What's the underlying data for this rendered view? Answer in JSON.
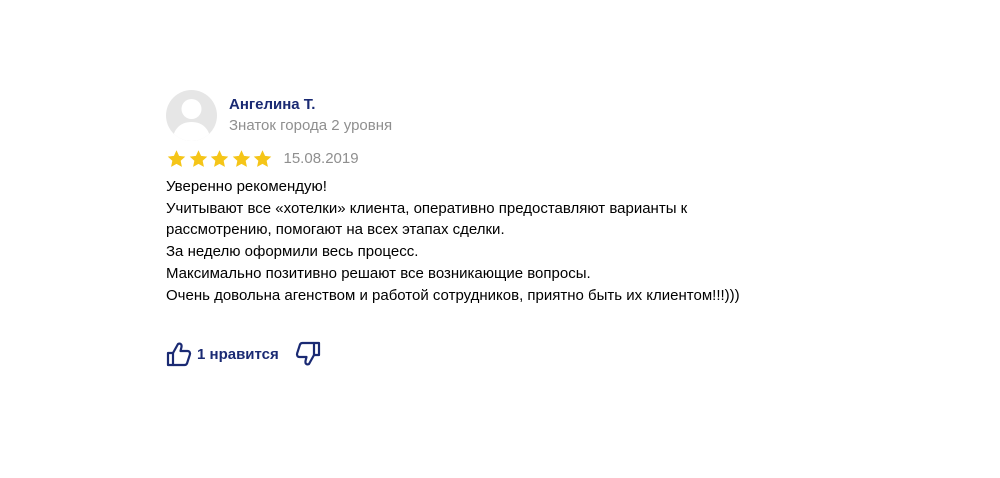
{
  "review": {
    "author_name": "Ангелина Т.",
    "author_level": "Знаток города 2 уровня",
    "rating": 5,
    "rating_max": 5,
    "date": "15.08.2019",
    "text_lines": [
      "Уверенно рекомендую!",
      "Учитывают все «хотелки» клиента, оперативно предоставляют варианты к",
      "рассмотрению, помогают на всех этапах сделки.",
      "За неделю оформили весь процесс.",
      "Максимально позитивно решают все возникающие вопросы.",
      "Очень довольна агенством и работой сотрудников, приятно быть их клиентом!!!)))"
    ],
    "likes_label": "1 нравится"
  },
  "colors": {
    "star": "#f5c518",
    "link": "#1a2a73",
    "muted": "#8f8f8f"
  },
  "icons": {
    "avatar": "user-silhouette-icon",
    "like": "thumbs-up-icon",
    "dislike": "thumbs-down-icon"
  }
}
